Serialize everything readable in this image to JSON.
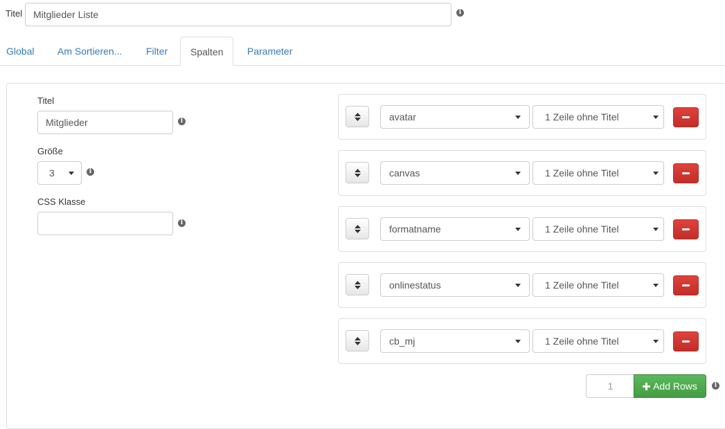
{
  "header": {
    "title_label": "Titel",
    "title_value": "Mitglieder Liste"
  },
  "tabs": [
    {
      "label": "Global"
    },
    {
      "label": "Am Sortieren..."
    },
    {
      "label": "Filter"
    },
    {
      "label": "Spalten",
      "active": true
    },
    {
      "label": "Parameter"
    }
  ],
  "left_form": {
    "title_label": "Titel",
    "title_value": "Mitglieder",
    "size_label": "Größe",
    "size_value": "3",
    "css_label": "CSS Klasse",
    "css_value": ""
  },
  "rows": [
    {
      "field": "avatar",
      "display": "1 Zeile ohne Titel"
    },
    {
      "field": "canvas",
      "display": "1 Zeile ohne Titel"
    },
    {
      "field": "formatname",
      "display": "1 Zeile ohne Titel"
    },
    {
      "field": "onlinestatus",
      "display": "1 Zeile ohne Titel"
    },
    {
      "field": "cb_mj",
      "display": "1 Zeile ohne Titel"
    }
  ],
  "add_rows": {
    "count": "1",
    "button_label": "Add Rows"
  },
  "colors": {
    "link": "#337ab7",
    "danger": "#d9534f",
    "success": "#5cb85c"
  },
  "icons": {
    "info": "info-icon",
    "drag": "sort-icon",
    "remove": "minus-icon",
    "add": "plus-icon"
  }
}
